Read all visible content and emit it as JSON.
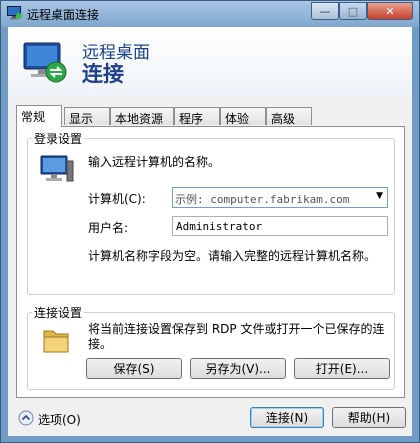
{
  "window": {
    "title": "远程桌面连接"
  },
  "titlebar_buttons": {
    "minimize": "—",
    "maximize": "□",
    "close": "✕"
  },
  "header": {
    "line1": "远程桌面",
    "line2": "连接"
  },
  "tabs": [
    {
      "label": "常规",
      "active": true
    },
    {
      "label": "显示"
    },
    {
      "label": "本地资源"
    },
    {
      "label": "程序"
    },
    {
      "label": "体验"
    },
    {
      "label": "高级"
    }
  ],
  "login": {
    "group_label": "登录设置",
    "instruction": "输入远程计算机的名称。",
    "computer_label": "计算机(C):",
    "computer_placeholder": "示例: computer.fabrikam.com",
    "username_label": "用户名:",
    "username_value": "Administrator",
    "message": "计算机名称字段为空。请输入完整的远程计算机名称。"
  },
  "connection": {
    "group_label": "连接设置",
    "description_line1": "将当前连接设置保存到 RDP 文件或打开一个已保存的连",
    "description_line2": "接。",
    "save_button": "保存(S)",
    "save_as_button": "另存为(V)...",
    "open_button": "打开(E)..."
  },
  "footer": {
    "options_label": "选项(O)",
    "connect_button": "连接(N)",
    "help_button": "帮助(H)"
  },
  "colors": {
    "title_bar": "#7ea6cf",
    "header_text": "#1e3f8a",
    "close_button": "#c7402c"
  }
}
